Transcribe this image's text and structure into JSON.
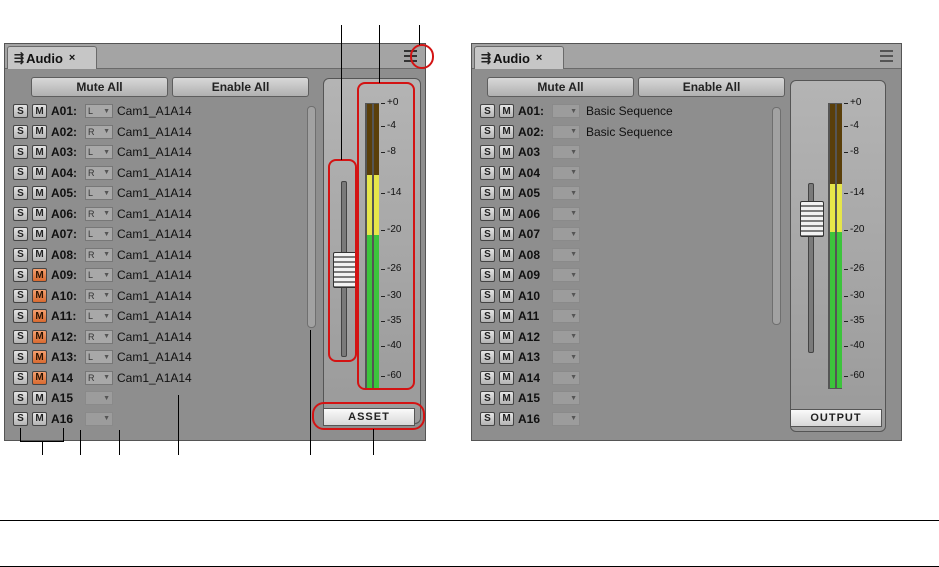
{
  "left_panel": {
    "tab_label": "Audio",
    "tab_close": "×",
    "wave_glyph": "⇶",
    "mute_all": "Mute All",
    "enable_all": "Enable All",
    "meter_button": "ASSET",
    "tracks": [
      {
        "s": "S",
        "m": "M",
        "name": "A01:",
        "ch": "L",
        "source": "Cam1_A1A14",
        "m_on": false
      },
      {
        "s": "S",
        "m": "M",
        "name": "A02:",
        "ch": "R",
        "source": "Cam1_A1A14",
        "m_on": false
      },
      {
        "s": "S",
        "m": "M",
        "name": "A03:",
        "ch": "L",
        "source": "Cam1_A1A14",
        "m_on": false
      },
      {
        "s": "S",
        "m": "M",
        "name": "A04:",
        "ch": "R",
        "source": "Cam1_A1A14",
        "m_on": false
      },
      {
        "s": "S",
        "m": "M",
        "name": "A05:",
        "ch": "L",
        "source": "Cam1_A1A14",
        "m_on": false
      },
      {
        "s": "S",
        "m": "M",
        "name": "A06:",
        "ch": "R",
        "source": "Cam1_A1A14",
        "m_on": false
      },
      {
        "s": "S",
        "m": "M",
        "name": "A07:",
        "ch": "L",
        "source": "Cam1_A1A14",
        "m_on": false
      },
      {
        "s": "S",
        "m": "M",
        "name": "A08:",
        "ch": "R",
        "source": "Cam1_A1A14",
        "m_on": false
      },
      {
        "s": "S",
        "m": "M",
        "name": "A09:",
        "ch": "L",
        "source": "Cam1_A1A14",
        "m_on": true
      },
      {
        "s": "S",
        "m": "M",
        "name": "A10:",
        "ch": "R",
        "source": "Cam1_A1A14",
        "m_on": true
      },
      {
        "s": "S",
        "m": "M",
        "name": "A11:",
        "ch": "L",
        "source": "Cam1_A1A14",
        "m_on": true
      },
      {
        "s": "S",
        "m": "M",
        "name": "A12:",
        "ch": "R",
        "source": "Cam1_A1A14",
        "m_on": true
      },
      {
        "s": "S",
        "m": "M",
        "name": "A13:",
        "ch": "L",
        "source": "Cam1_A1A14",
        "m_on": true
      },
      {
        "s": "S",
        "m": "M",
        "name": "A14",
        "ch": "R",
        "source": "Cam1_A1A14",
        "m_on": true
      },
      {
        "s": "S",
        "m": "M",
        "name": "A15",
        "ch": "",
        "source": "",
        "m_on": false
      },
      {
        "s": "S",
        "m": "M",
        "name": "A16",
        "ch": "",
        "source": "",
        "m_on": false
      }
    ]
  },
  "right_panel": {
    "tab_label": "Audio",
    "tab_close": "×",
    "wave_glyph": "⇶",
    "mute_all": "Mute All",
    "enable_all": "Enable All",
    "meter_button": "OUTPUT",
    "tracks": [
      {
        "s": "S",
        "m": "M",
        "name": "A01:",
        "source": "Basic Sequence"
      },
      {
        "s": "S",
        "m": "M",
        "name": "A02:",
        "source": "Basic Sequence"
      },
      {
        "s": "S",
        "m": "M",
        "name": "A03",
        "source": ""
      },
      {
        "s": "S",
        "m": "M",
        "name": "A04",
        "source": ""
      },
      {
        "s": "S",
        "m": "M",
        "name": "A05",
        "source": ""
      },
      {
        "s": "S",
        "m": "M",
        "name": "A06",
        "source": ""
      },
      {
        "s": "S",
        "m": "M",
        "name": "A07",
        "source": ""
      },
      {
        "s": "S",
        "m": "M",
        "name": "A08",
        "source": ""
      },
      {
        "s": "S",
        "m": "M",
        "name": "A09",
        "source": ""
      },
      {
        "s": "S",
        "m": "M",
        "name": "A10",
        "source": ""
      },
      {
        "s": "S",
        "m": "M",
        "name": "A11",
        "source": ""
      },
      {
        "s": "S",
        "m": "M",
        "name": "A12",
        "source": ""
      },
      {
        "s": "S",
        "m": "M",
        "name": "A13",
        "source": ""
      },
      {
        "s": "S",
        "m": "M",
        "name": "A14",
        "source": ""
      },
      {
        "s": "S",
        "m": "M",
        "name": "A15",
        "source": ""
      },
      {
        "s": "S",
        "m": "M",
        "name": "A16",
        "source": ""
      }
    ]
  },
  "meter_scale": [
    "+0",
    "-4",
    "-8",
    "-14",
    "-20",
    "-26",
    "-30",
    "-35",
    "-40",
    "-60"
  ],
  "colors": {
    "annotation_red": "#d31313",
    "meter_green": "#3cc43c",
    "meter_yellow": "#e6e64a",
    "meter_dark": "#5a3f0a",
    "mute_active": "#e07a40"
  }
}
